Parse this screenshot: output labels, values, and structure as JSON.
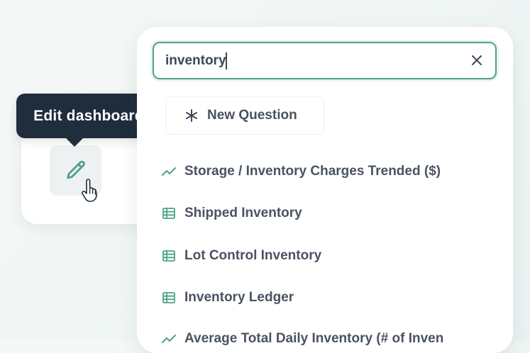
{
  "tooltip": {
    "label": "Edit dashboard"
  },
  "search": {
    "value": "inventory",
    "clear_icon": "close-icon"
  },
  "new_question": {
    "label": "New Question",
    "icon": "asterisk-icon"
  },
  "results": [
    {
      "label": "Storage / Inventory Charges Trended ($)",
      "icon": "line-chart-icon"
    },
    {
      "label": "Shipped Inventory",
      "icon": "table-icon"
    },
    {
      "label": "Lot Control Inventory",
      "icon": "table-icon"
    },
    {
      "label": "Inventory Ledger",
      "icon": "table-icon"
    },
    {
      "label": "Average Total Daily Inventory (# of Inven",
      "icon": "line-chart-icon"
    }
  ],
  "colors": {
    "accent": "#4ea28a",
    "tooltip_bg": "#1f2d3d",
    "text": "#4a5360"
  }
}
